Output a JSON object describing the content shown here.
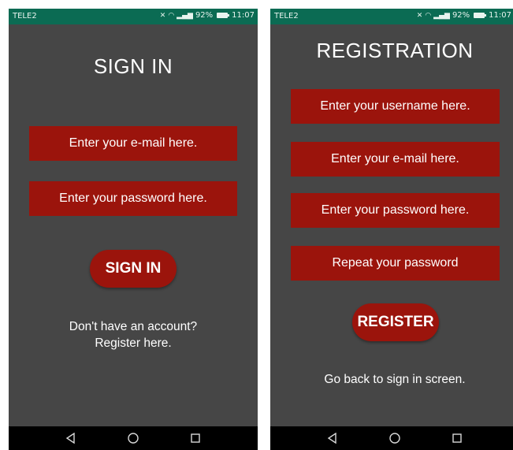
{
  "status_bar": {
    "carrier": "TELE2",
    "battery": "92%",
    "time": "11:07"
  },
  "sign_in_screen": {
    "title": "SIGN IN",
    "email_placeholder": "Enter your e-mail here.",
    "password_placeholder": "Enter your password here.",
    "sign_in_button": "SIGN IN",
    "register_prompt_line1": "Don't have an account?",
    "register_prompt_line2": "Register here."
  },
  "registration_screen": {
    "title": "REGISTRATION",
    "username_placeholder": "Enter your username here.",
    "email_placeholder": "Enter your e-mail here.",
    "password_placeholder": "Enter your password here.",
    "repeat_password_placeholder": "Repeat your password",
    "register_button": "REGISTER",
    "back_link": "Go back to sign in screen."
  },
  "colors": {
    "field_background": "#9b140c",
    "screen_background": "#464646",
    "status_bar": "#0b6b53",
    "nav_bar": "#000000"
  },
  "icons": {
    "nav_back": "triangle-back-icon",
    "nav_home": "circle-home-icon",
    "nav_recent": "square-recent-icon"
  }
}
